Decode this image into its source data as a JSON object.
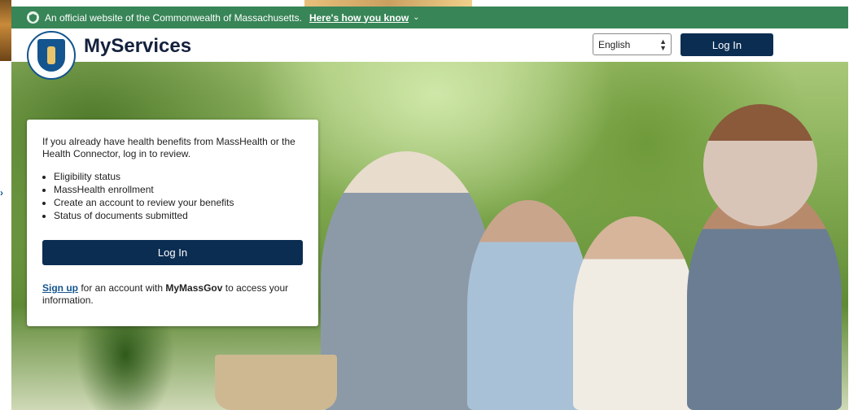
{
  "banner": {
    "text": "An official website of the Commonwealth of Massachusetts.",
    "link": "Here's how you know",
    "color": "#388557"
  },
  "header": {
    "brand": "MyServices",
    "language": "English",
    "login": "Log In",
    "accent": "#0b2d52"
  },
  "card": {
    "intro": "If you already have health benefits from MassHealth or the Health Connector, log in to review.",
    "items": [
      "Eligibility status",
      "MassHealth enrollment",
      "Create an account to review your benefits",
      "Status of documents submitted"
    ],
    "login": "Log In",
    "signup_link": "Sign up",
    "signup_mid": " for an account with ",
    "signup_brand": "MyMassGov",
    "signup_end": " to access your information."
  },
  "icons": {
    "banner": "shield-icon",
    "chevron": "chevron-down-icon",
    "seal": "state-seal-icon"
  }
}
